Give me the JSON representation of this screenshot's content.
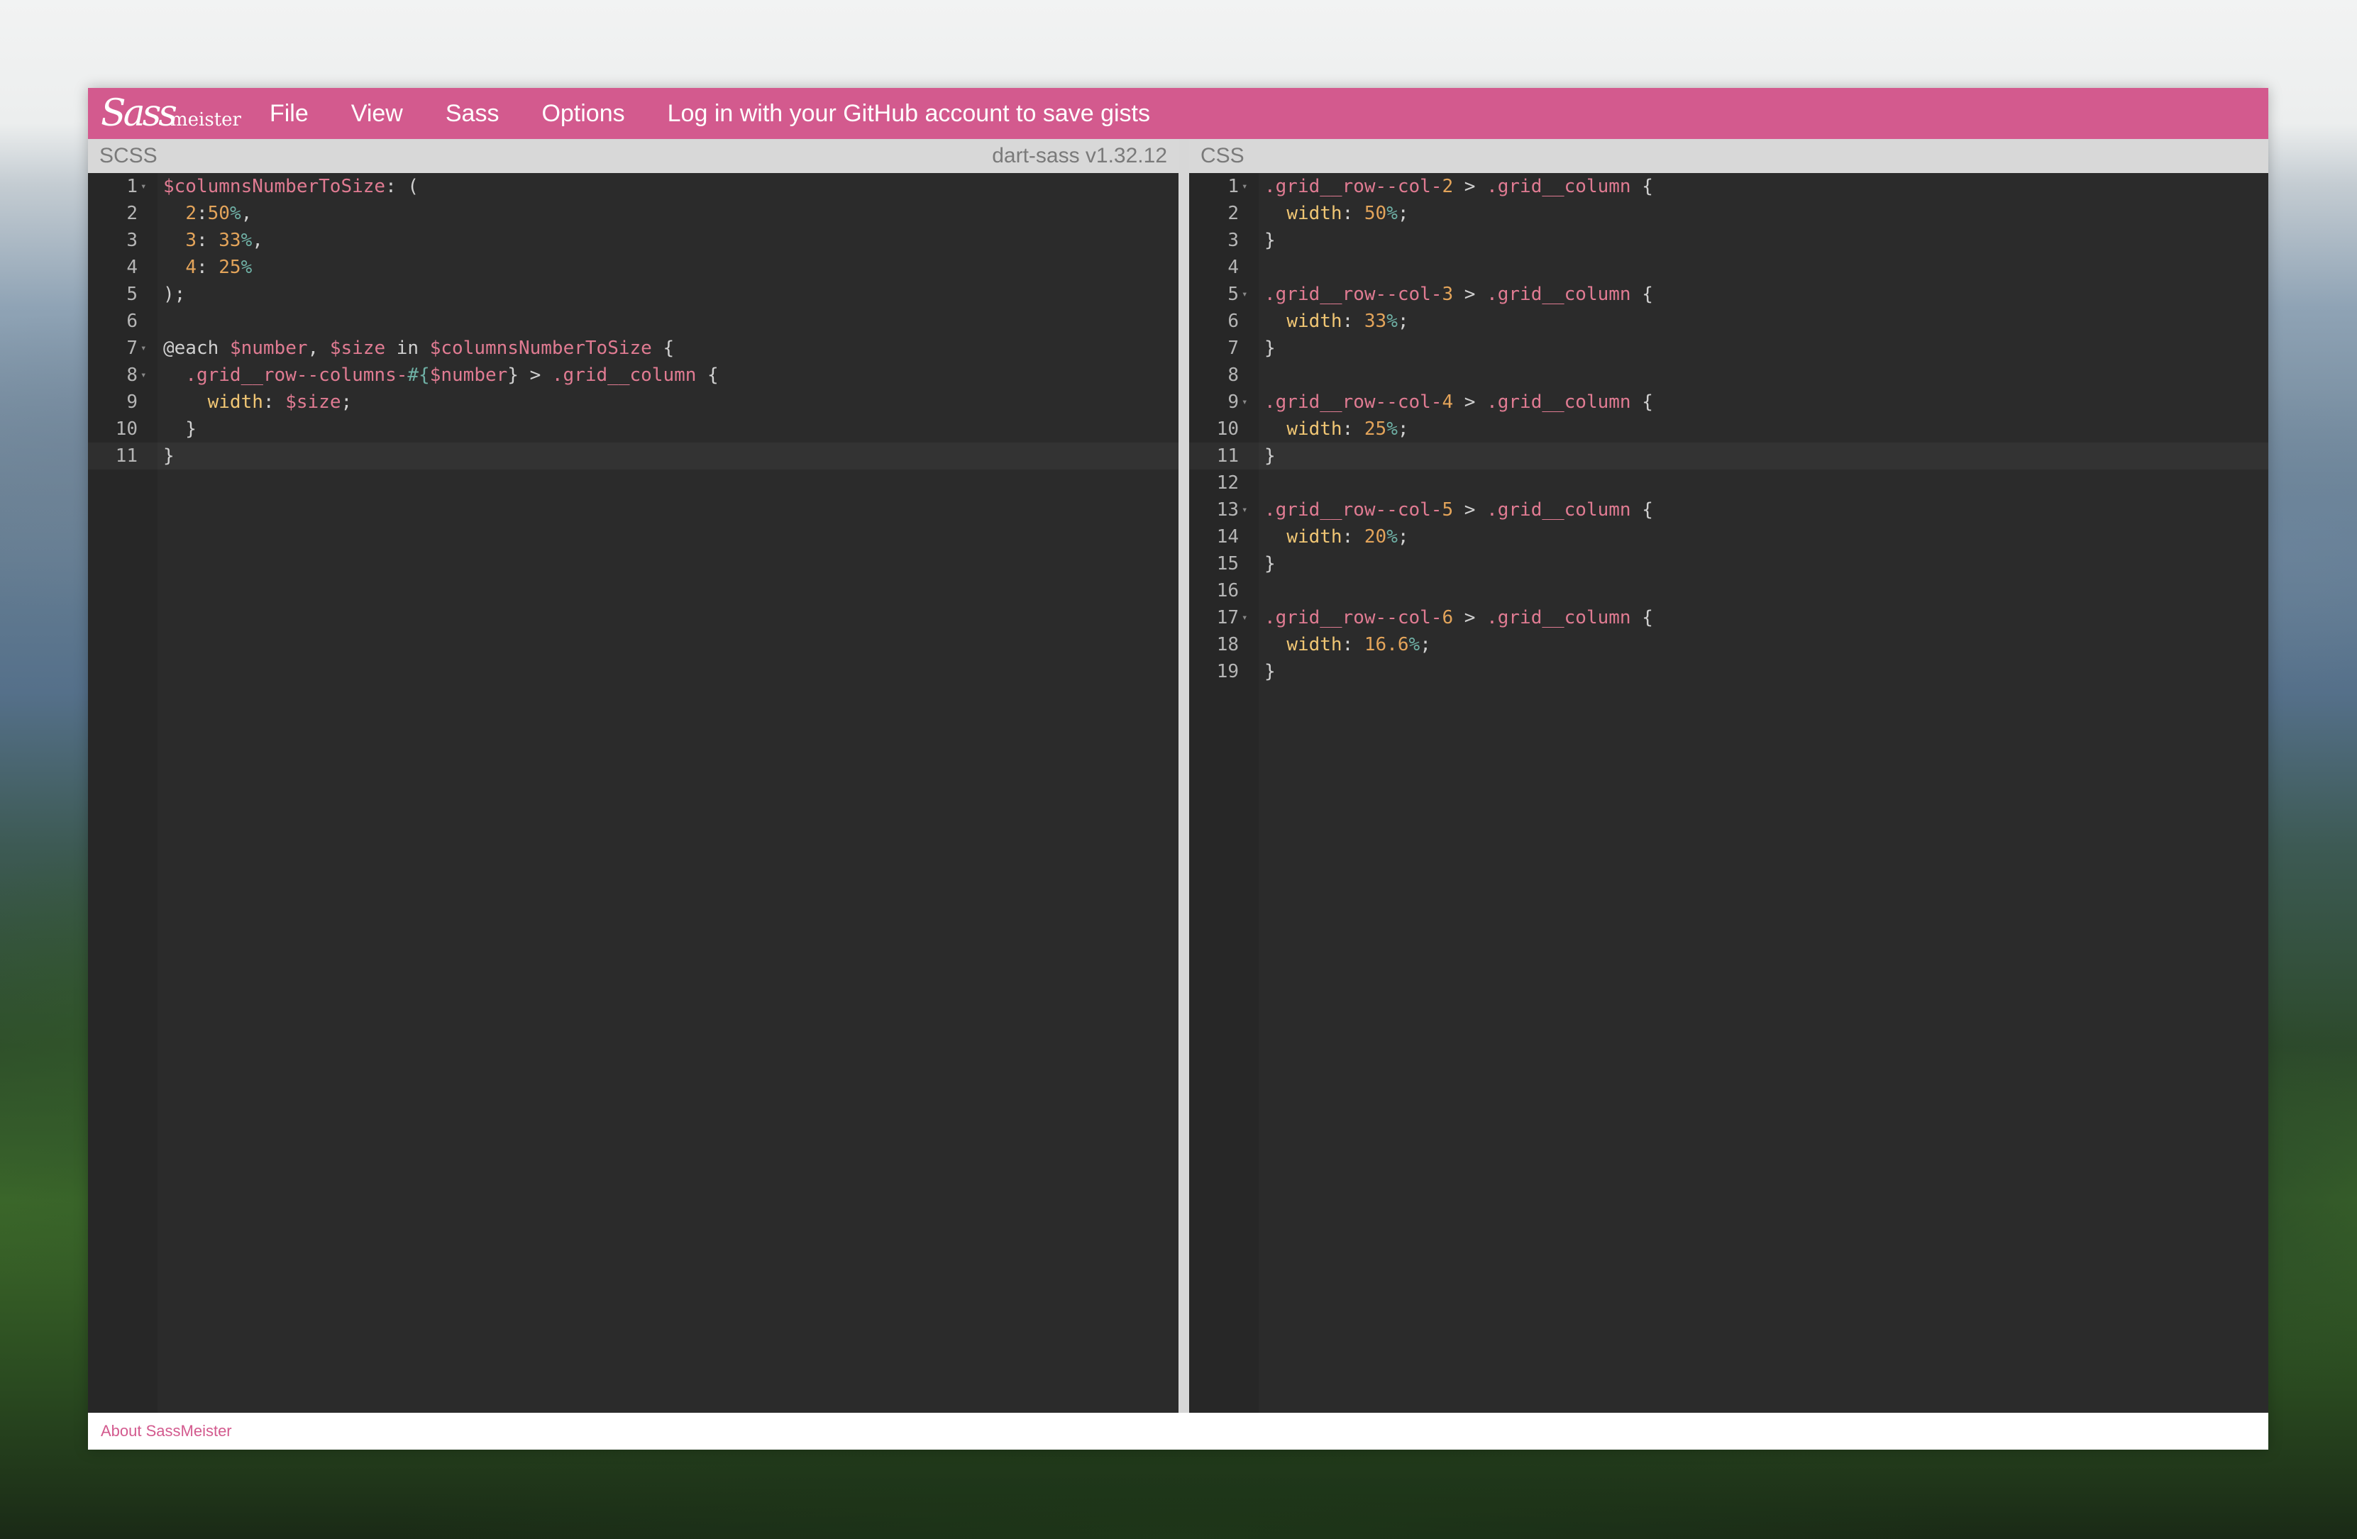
{
  "topbar": {
    "logo_script": "Sass",
    "logo_word": "meister",
    "menu": [
      "File",
      "View",
      "Sass",
      "Options"
    ],
    "login": "Log in with your GitHub account to save gists",
    "accent_color": "#d35a8e"
  },
  "scss_pane": {
    "title": "SCSS",
    "version": "dart-sass v1.32.12",
    "lines": [
      "$columnsNumberToSize: (",
      "  2:50%,",
      "  3: 33%,",
      "  4: 25%",
      ");",
      "",
      "@each $number, $size in $columnsNumberToSize {",
      "  .grid__row--columns-#{$number} > .grid__column {",
      "    width: $size;",
      "  }",
      "}"
    ],
    "line_numbers": [
      "1",
      "2",
      "3",
      "4",
      "5",
      "6",
      "7",
      "8",
      "9",
      "10",
      "11"
    ],
    "active_line": 11
  },
  "css_pane": {
    "title": "CSS",
    "lines": [
      ".grid__row--col-2 > .grid__column {",
      "  width: 50%;",
      "}",
      "",
      ".grid__row--col-3 > .grid__column {",
      "  width: 33%;",
      "}",
      "",
      ".grid__row--col-4 > .grid__column {",
      "  width: 25%;",
      "}",
      "",
      ".grid__row--col-5 > .grid__column {",
      "  width: 20%;",
      "}",
      "",
      ".grid__row--col-6 > .grid__column {",
      "  width: 16.6%;",
      "}"
    ],
    "line_numbers": [
      "1",
      "2",
      "3",
      "4",
      "5",
      "6",
      "7",
      "8",
      "9",
      "10",
      "11",
      "12",
      "13",
      "14",
      "15",
      "16",
      "17",
      "18",
      "19"
    ],
    "active_line": 11
  },
  "footer": {
    "about_link": "About SassMeister"
  }
}
